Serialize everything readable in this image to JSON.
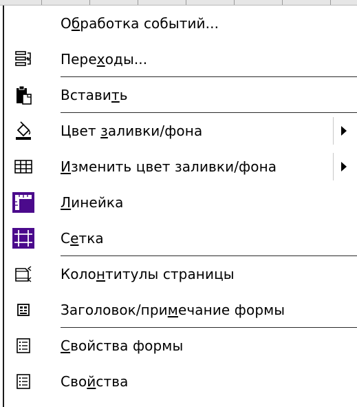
{
  "colors": {
    "text": "#000000",
    "icon_accent": "#4b0a8c",
    "separator": "#2a2a2a",
    "background": "#ffffff"
  },
  "menu": {
    "items": [
      {
        "label_parts": [
          "О",
          "б",
          "работка событий..."
        ],
        "icon": "none",
        "has_submenu": false
      },
      {
        "label_parts": [
          "Пере",
          "х",
          "оды..."
        ],
        "icon": "transitions-icon",
        "has_submenu": false
      },
      {
        "label_parts": [
          "Встави",
          "т",
          "ь"
        ],
        "icon": "paste-icon",
        "has_submenu": false
      },
      {
        "label_parts": [
          "Цвет ",
          "з",
          "аливки/фона"
        ],
        "icon": "fill-color-icon",
        "has_submenu": true
      },
      {
        "label_parts": [
          "",
          "И",
          "зменить цвет заливки/фона"
        ],
        "icon": "alternate-fill-icon",
        "has_submenu": true
      },
      {
        "label_parts": [
          "",
          "Л",
          "инейка"
        ],
        "icon": "ruler-icon",
        "has_submenu": false
      },
      {
        "label_parts": [
          "С",
          "е",
          "тка"
        ],
        "icon": "grid-icon",
        "has_submenu": false
      },
      {
        "label_parts": [
          "Коло",
          "н",
          "титулы страницы"
        ],
        "icon": "page-header-footer-icon",
        "has_submenu": false
      },
      {
        "label_parts": [
          "Заголовок/при",
          "м",
          "ечание формы"
        ],
        "icon": "form-header-footer-icon",
        "has_submenu": false
      },
      {
        "label_parts": [
          "",
          "С",
          "войства формы"
        ],
        "icon": "form-properties-icon",
        "has_submenu": false
      },
      {
        "label_parts": [
          "Сво",
          "й",
          "ства"
        ],
        "icon": "properties-icon",
        "has_submenu": false
      }
    ]
  }
}
